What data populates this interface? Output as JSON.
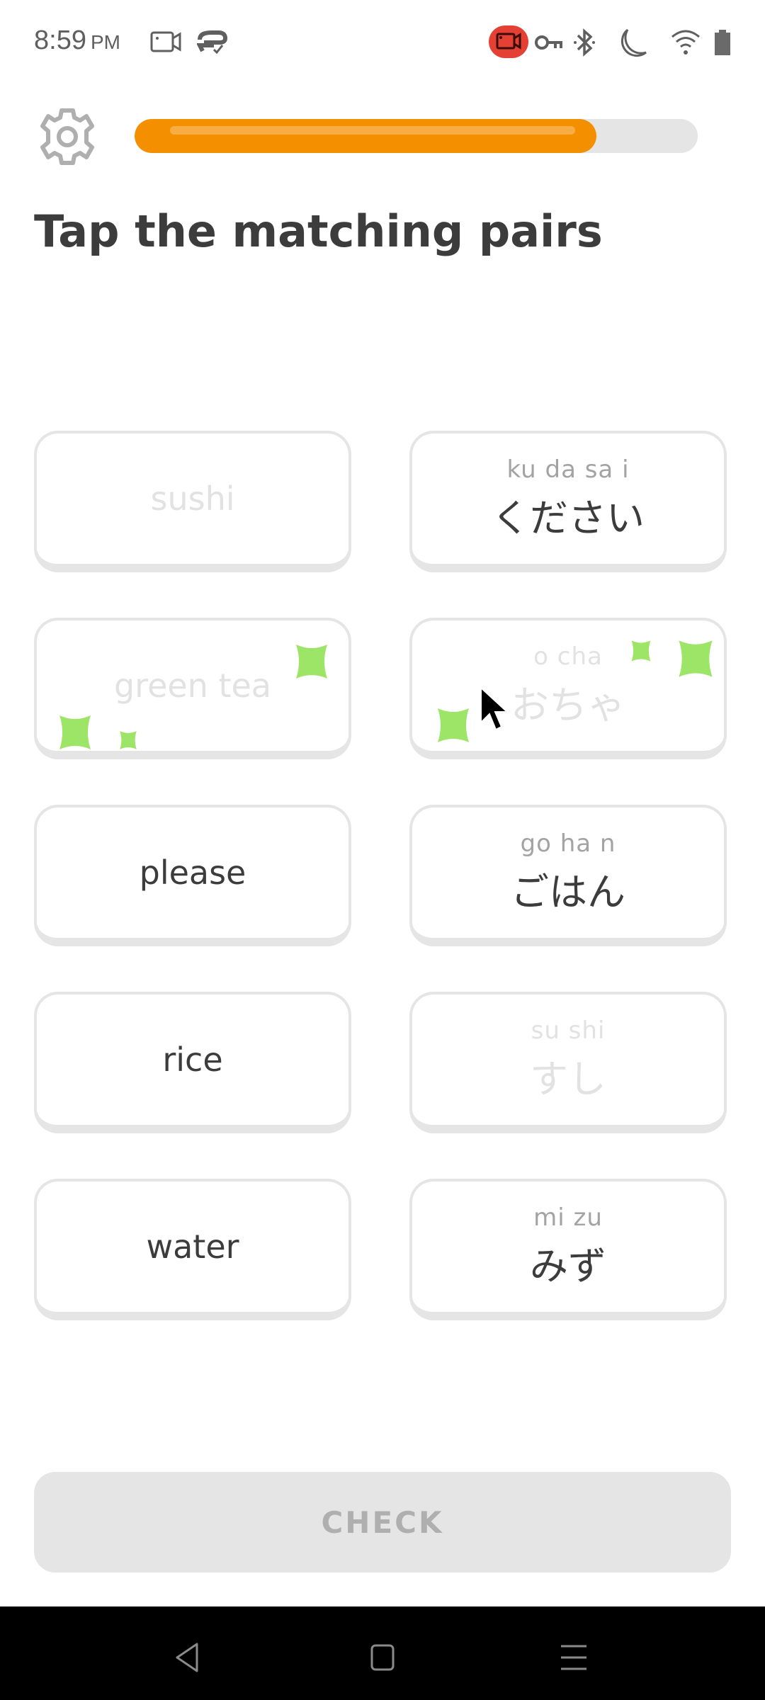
{
  "status_bar": {
    "time": "8:59",
    "ampm": "PM",
    "icons": [
      "screen-record-icon",
      "data-saver-icon",
      "recording-active-icon",
      "vpn-key-icon",
      "bluetooth-icon",
      "do-not-disturb-moon-icon",
      "wifi-icon",
      "battery-icon"
    ],
    "recording_color": "#e44134"
  },
  "header": {
    "settings_icon": "gear-icon",
    "progress_percent": 82,
    "progress_color": "#f49000"
  },
  "title": "Tap the matching pairs",
  "tiles": {
    "left": [
      {
        "word": "sushi",
        "state": "matched"
      },
      {
        "word": "green tea",
        "state": "matched"
      },
      {
        "word": "please",
        "state": "available"
      },
      {
        "word": "rice",
        "state": "available"
      },
      {
        "word": "water",
        "state": "available"
      }
    ],
    "right": [
      {
        "romaji": "ku da sa  i",
        "kana": "ください",
        "state": "available"
      },
      {
        "romaji": "o   cha",
        "kana": "おちゃ",
        "state": "matched"
      },
      {
        "romaji": "go ha  n",
        "kana": "ごはん",
        "state": "available"
      },
      {
        "romaji": "su shi",
        "kana": "すし",
        "state": "matched"
      },
      {
        "romaji": "mi zu",
        "kana": "みず",
        "state": "available"
      }
    ],
    "sparkle_color": "#9de567"
  },
  "check_button": {
    "label": "CHECK",
    "state": "disabled"
  },
  "nav_bar": {
    "icons": [
      "back-icon",
      "home-icon",
      "recents-icon"
    ]
  }
}
